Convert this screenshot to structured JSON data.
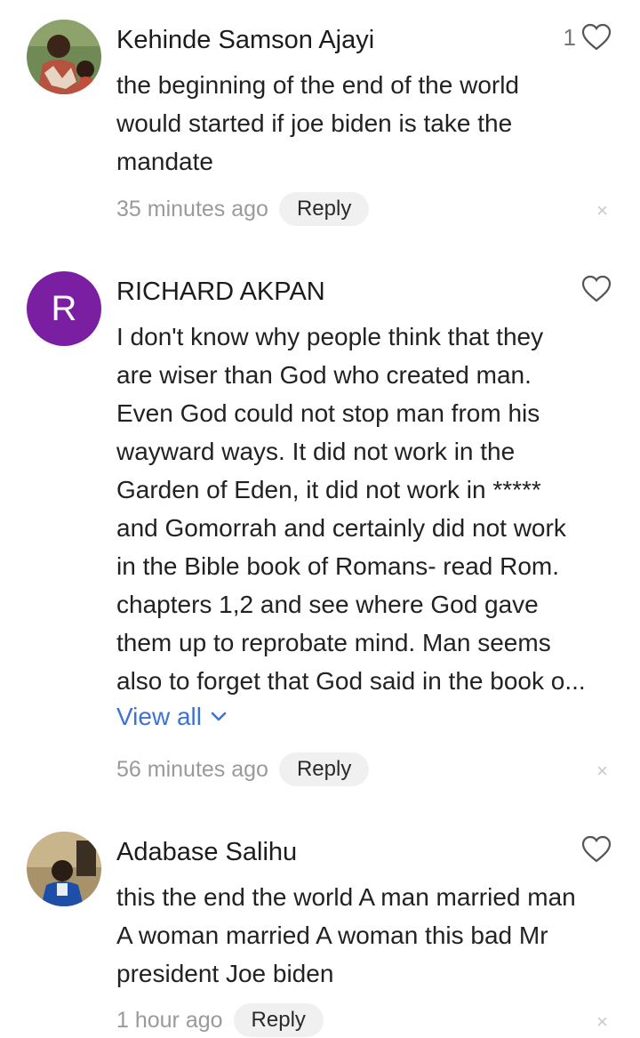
{
  "comments": [
    {
      "author": "Kehinde Samson Ajayi",
      "avatar_icon": "user-photo-avatar",
      "like_count": "1",
      "lines": [
        "the beginning of the end of the world",
        "would started if joe biden is take the",
        "mandate"
      ],
      "timestamp": "35 minutes ago",
      "reply_label": "Reply"
    },
    {
      "author": "RICHARD AKPAN",
      "avatar_letter": "R",
      "avatar_color": "#7b1fa2",
      "lines": [
        "I don't know why people think that they",
        "are wiser than God who created man.",
        "Even God could not stop man from his",
        "wayward ways. It did not work in the",
        "Garden of Eden, it did not work in *****",
        "and Gomorrah and certainly did not work",
        "in the Bible book of Romans- read Rom.",
        "chapters 1,2 and see where God gave",
        "them up to reprobate mind. Man seems",
        "also to forget that God said in the book o..."
      ],
      "view_all_label": "View all",
      "timestamp": "56 minutes ago",
      "reply_label": "Reply"
    },
    {
      "author": "Adabase Salihu",
      "avatar_icon": "user-photo-avatar",
      "lines": [
        "this the end the world A man married man",
        "A woman married A woman this bad Mr",
        "president Joe biden"
      ],
      "timestamp": "1 hour ago",
      "reply_label": "Reply"
    }
  ],
  "close_symbol": "×",
  "colors": {
    "link": "#3e73d6",
    "muted": "#9a9a9a",
    "avatar_purple": "#7b1fa2"
  }
}
